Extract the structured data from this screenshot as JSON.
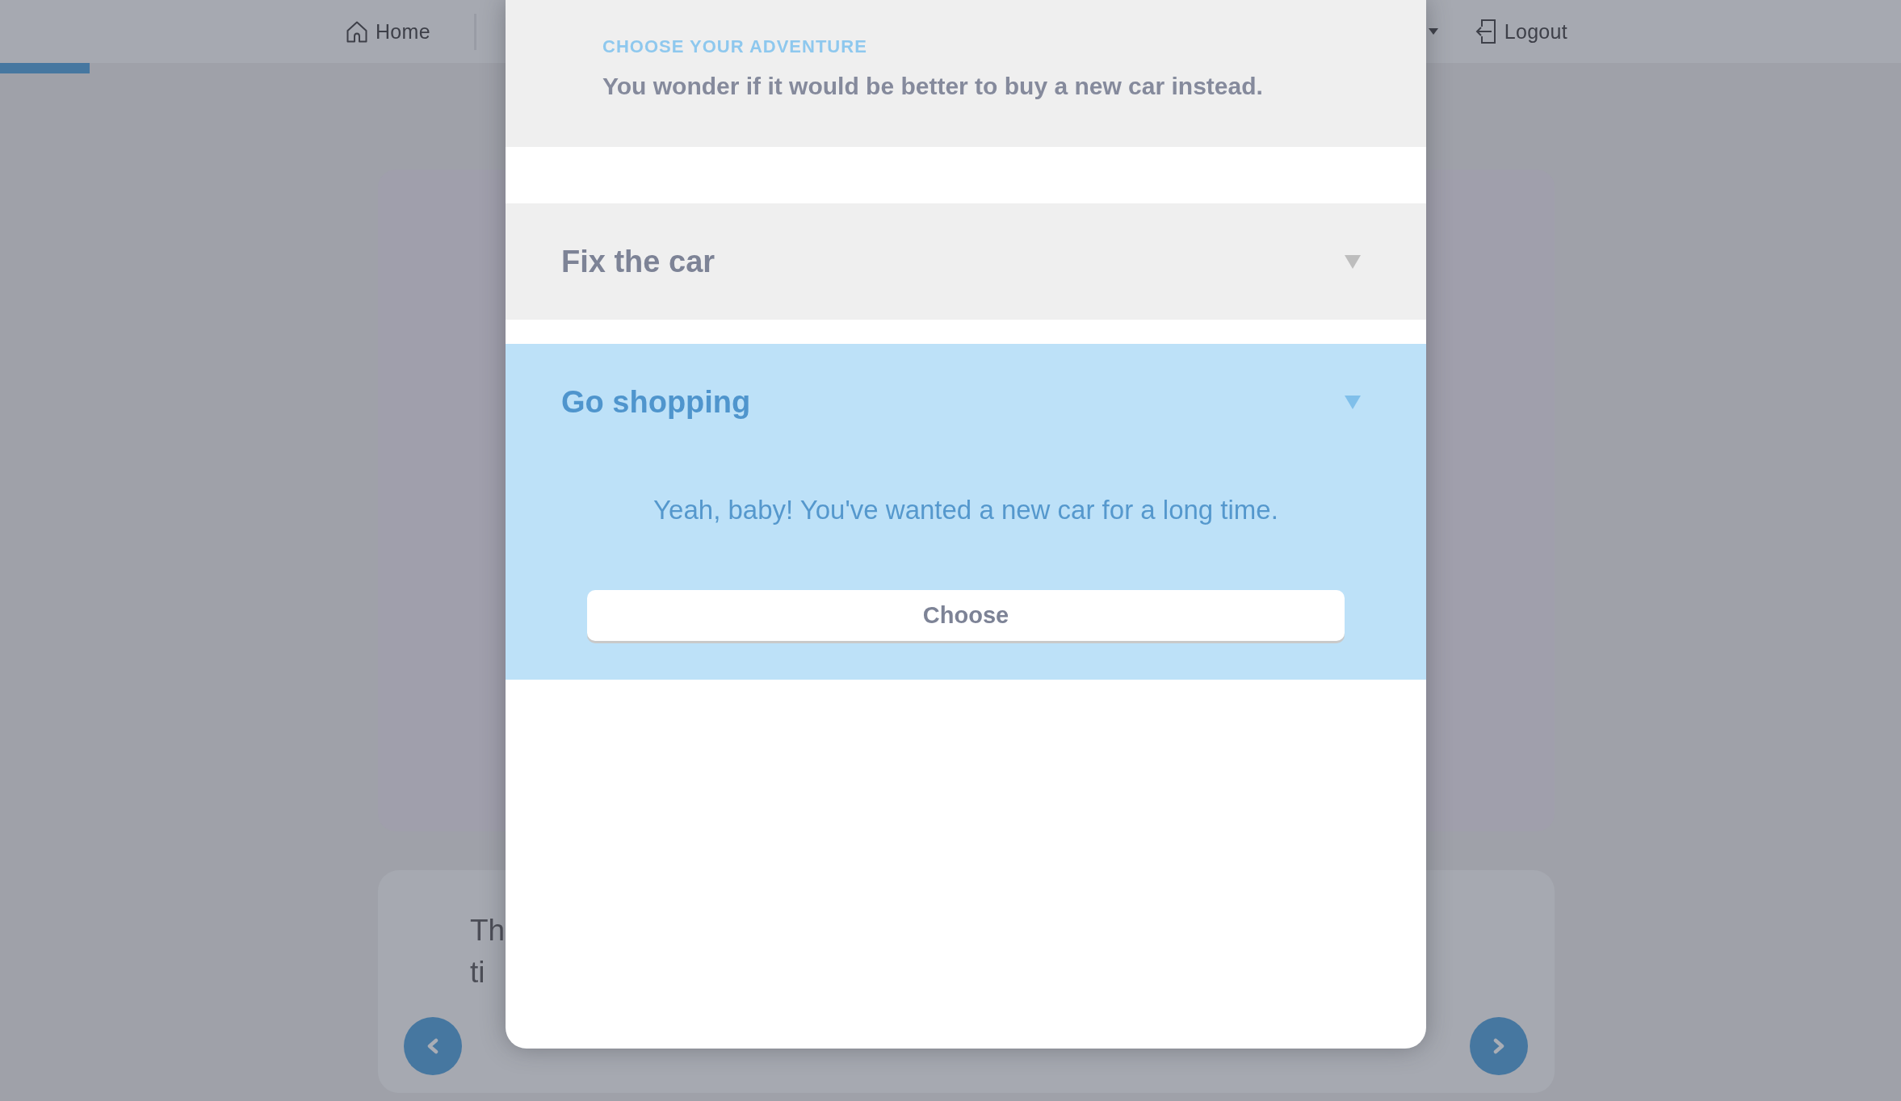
{
  "nav": {
    "home_link": {
      "label": "Home"
    },
    "logout_link": {
      "label": "Logout"
    }
  },
  "progress": {
    "level": 0.047
  },
  "story": {
    "text_lines": [
      "Th",
      "ti"
    ]
  },
  "modal": {
    "eyebrow": "CHOOSE YOUR ADVENTURE",
    "prompt": "You wonder if it would be better to buy a new car instead.",
    "options": [
      {
        "title": "Fix the car",
        "expanded": false
      },
      {
        "title": "Go shopping",
        "expanded": true,
        "description": "Yeah, baby! You've wanted a new car for a long time.",
        "button": "Choose"
      }
    ]
  }
}
